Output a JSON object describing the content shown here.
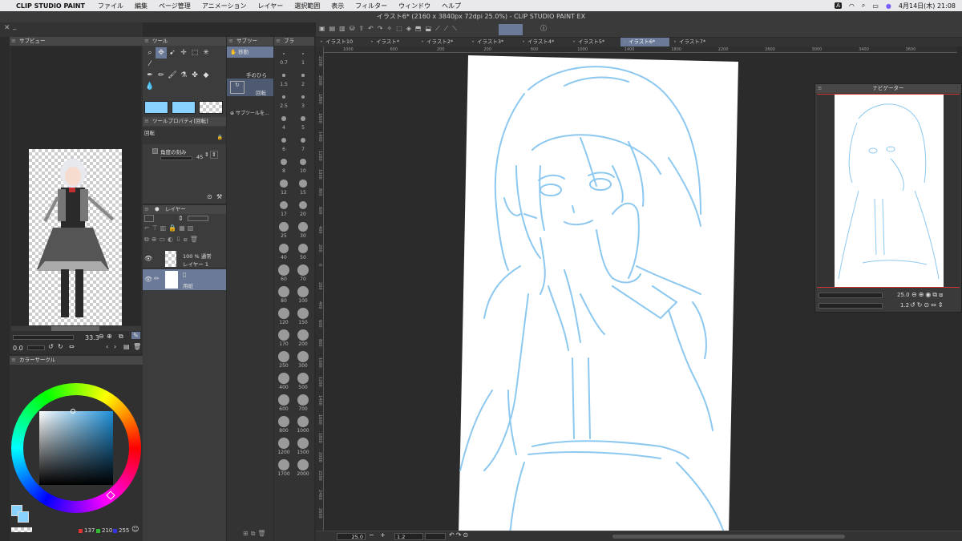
{
  "menubar": {
    "app": "CLIP STUDIO PAINT",
    "items": [
      "ファイル",
      "編集",
      "ページ管理",
      "アニメーション",
      "レイヤー",
      "選択範囲",
      "表示",
      "フィルター",
      "ウィンドウ",
      "ヘルプ"
    ],
    "input_badge": "A",
    "clock": "4月14日(木)  21:08"
  },
  "window_title": "イラスト6* (2160 x 3840px 72dpi 25.0%)  - CLIP STUDIO PAINT EX",
  "subview": {
    "title": "サブビュー",
    "zoom": "33.3",
    "angle": "0.0"
  },
  "tool_panel": {
    "title": "ツール"
  },
  "subtool_panel": {
    "title": "サブツー",
    "items": [
      "移動",
      "手のひら",
      "回転"
    ],
    "add_label": "サブツールを..."
  },
  "brush_panel": {
    "title": "ブラ",
    "sizes": [
      "0.7",
      "1",
      "1.5",
      "2",
      "2.5",
      "3",
      "4",
      "5",
      "6",
      "7",
      "8",
      "10",
      "12",
      "15",
      "17",
      "20",
      "25",
      "30",
      "40",
      "50",
      "60",
      "70",
      "80",
      "100",
      "120",
      "150",
      "170",
      "200",
      "250",
      "300",
      "400",
      "500",
      "600",
      "700",
      "800",
      "1000",
      "1200",
      "1500",
      "1700",
      "2000"
    ]
  },
  "tool_property": {
    "title": "ツールプロパティ[回転]",
    "tool_name": "回転",
    "snap_label": "角度の刻み",
    "snap_value": "45"
  },
  "layer_panel": {
    "title": "レイヤー",
    "layers": [
      {
        "mode": "100 % 通常",
        "name": "レイヤー 1"
      },
      {
        "mode": "",
        "name": "用紙"
      }
    ]
  },
  "color_panel": {
    "title": "カラーサークル",
    "r": "137",
    "g": "210",
    "b": "255"
  },
  "doc_tabs": [
    "イラスト10",
    "イラスト*",
    "イラスト2*",
    "イラスト3*",
    "イラスト4*",
    "イラスト5*",
    "イラスト6*",
    "イラスト7*"
  ],
  "active_tab_index": 6,
  "ruler_top": [
    "1000",
    "600",
    "200",
    "200",
    "600",
    "1000",
    "1400",
    "1800",
    "2200",
    "2600",
    "3000",
    "3400",
    "3600"
  ],
  "ruler_left": [
    "2200",
    "2000",
    "1800",
    "1600",
    "1400",
    "1200",
    "1000",
    "800",
    "600",
    "400",
    "200",
    "0",
    "200",
    "400",
    "600",
    "800",
    "1000",
    "1200",
    "1400",
    "1600",
    "1800",
    "2000",
    "2200",
    "2400",
    "2600"
  ],
  "status": {
    "zoom": "25.0",
    "angle": "1.2"
  },
  "navigator": {
    "title": "ナビゲーター",
    "zoom": "25.0",
    "angle": "1.2"
  },
  "colors": {
    "line": "#8cc8ef",
    "accent": "#6a7a98",
    "fg_color": "#89d2ff"
  }
}
